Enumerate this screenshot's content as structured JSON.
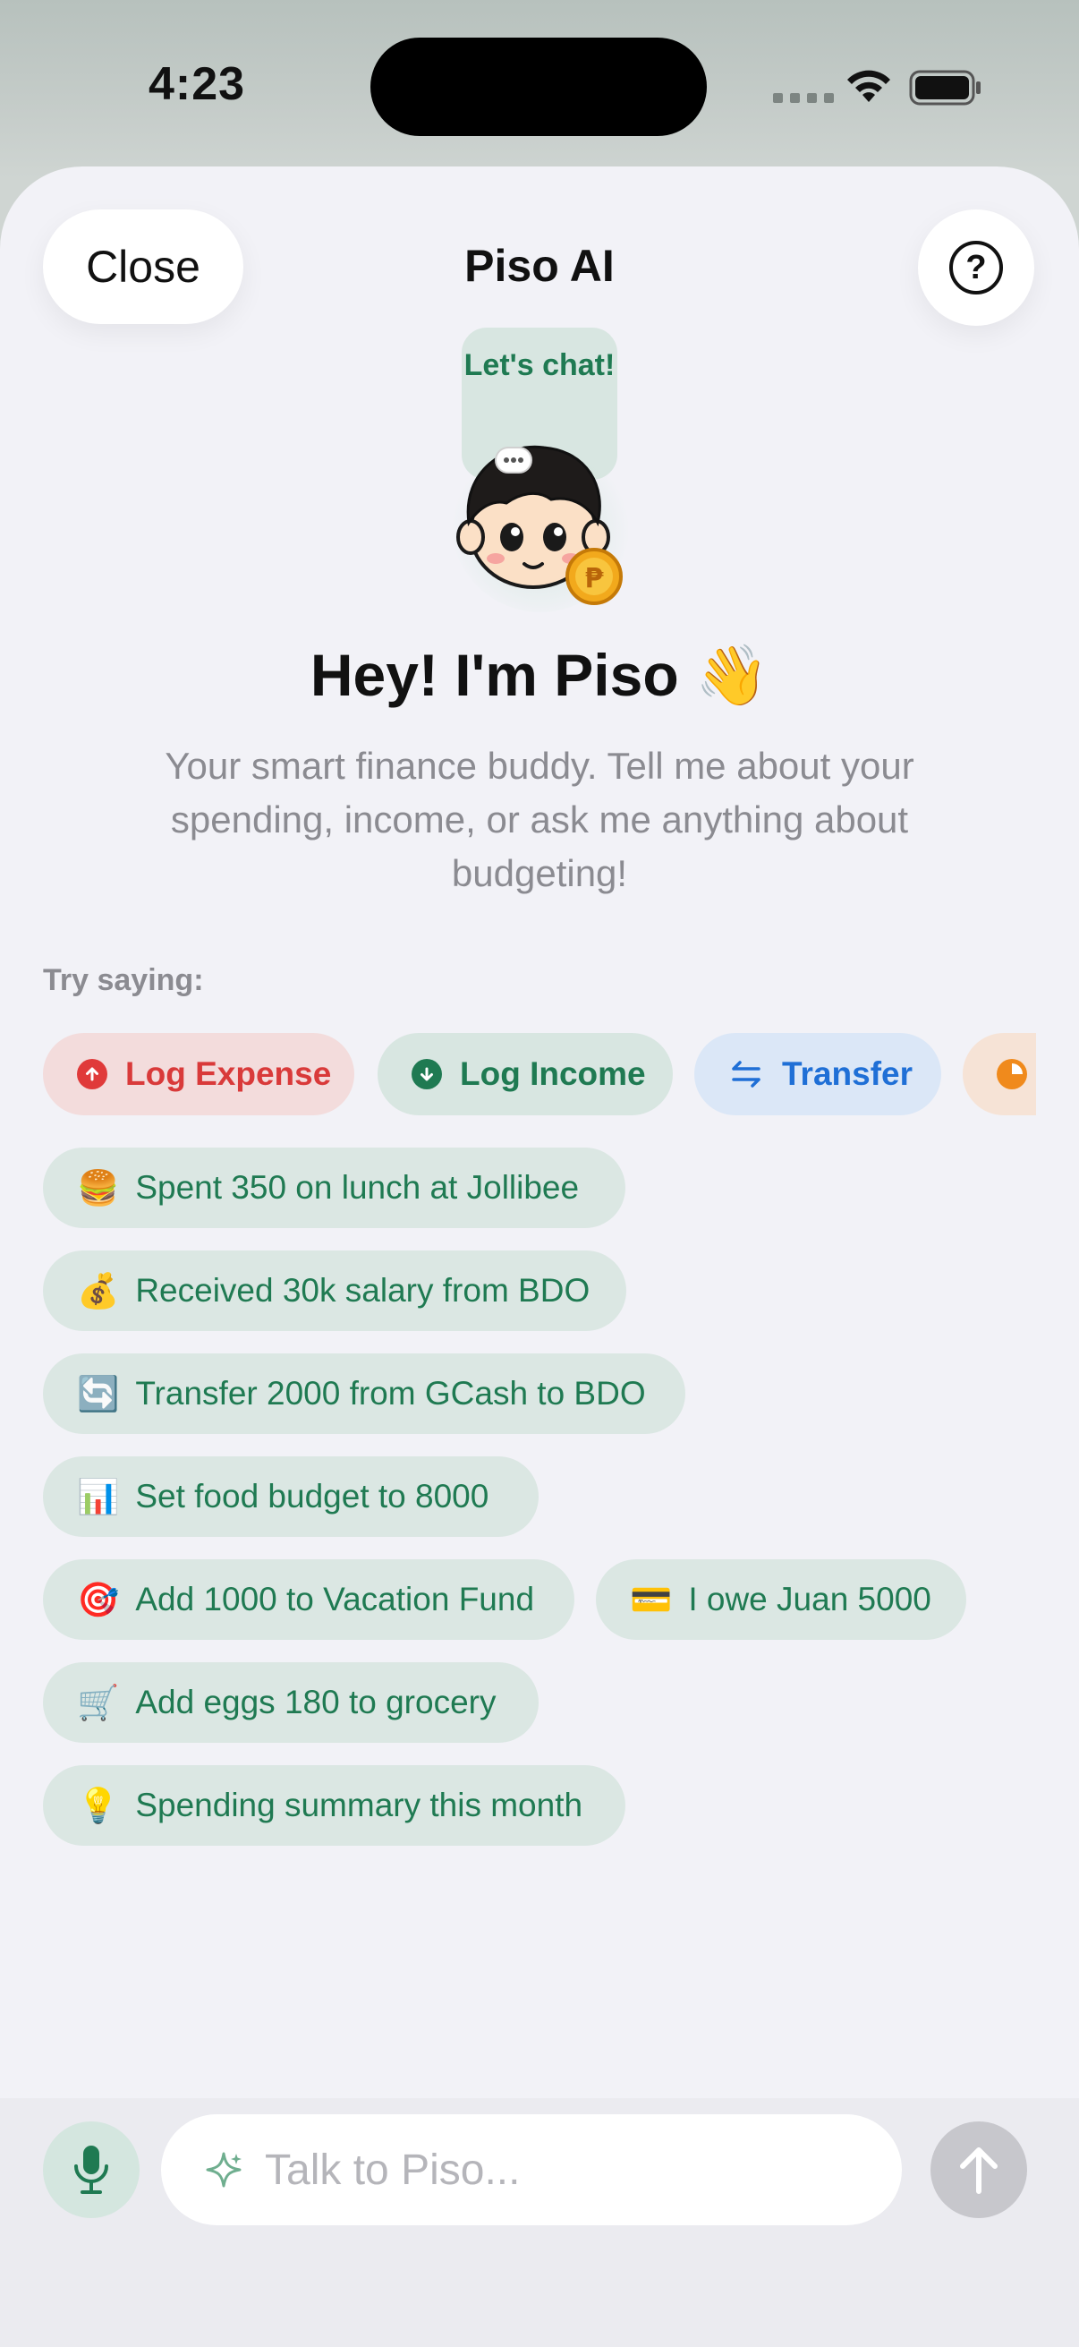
{
  "status_bar": {
    "time": "4:23"
  },
  "header": {
    "close_label": "Close",
    "title": "Piso AI",
    "help_icon": "question-circle-icon"
  },
  "mascot": {
    "bubble_text": "Let's chat!"
  },
  "hero": {
    "title": "Hey! I'm Piso 👋",
    "subtitle": "Your smart finance buddy. Tell me about your spending, income, or ask me anything about budgeting!"
  },
  "suggestions_label": "Try saying:",
  "quick_actions": [
    {
      "label": "Log Expense",
      "icon": "arrow-up-circle-icon",
      "color": "#d93a3a",
      "bg": "#f3dcdc"
    },
    {
      "label": "Log Income",
      "icon": "arrow-down-circle-icon",
      "color": "#1f7a52",
      "bg": "#d8e6e1"
    },
    {
      "label": "Transfer",
      "icon": "swap-arrows-icon",
      "color": "#1f6fd6",
      "bg": "#dbe7f7"
    },
    {
      "label": "",
      "icon": "pie-chart-icon",
      "color": "#f08a1c",
      "bg": "#f6e3d6"
    }
  ],
  "suggestions": [
    {
      "emoji": "🍔",
      "text": "Spent 350 on lunch at Jollibee"
    },
    {
      "emoji": "💰",
      "text": "Received 30k salary from BDO"
    },
    {
      "emoji": "🔄",
      "text": "Transfer 2000 from GCash to BDO"
    },
    {
      "emoji": "📊",
      "text": "Set food budget to 8000"
    },
    {
      "emoji": "🎯",
      "text": "Add 1000 to Vacation Fund"
    },
    {
      "emoji": "💳",
      "text": "I owe Juan 5000"
    },
    {
      "emoji": "🛒",
      "text": "Add eggs 180 to grocery"
    },
    {
      "emoji": "💡",
      "text": "Spending summary this month"
    }
  ],
  "composer": {
    "placeholder": "Talk to Piso..."
  }
}
